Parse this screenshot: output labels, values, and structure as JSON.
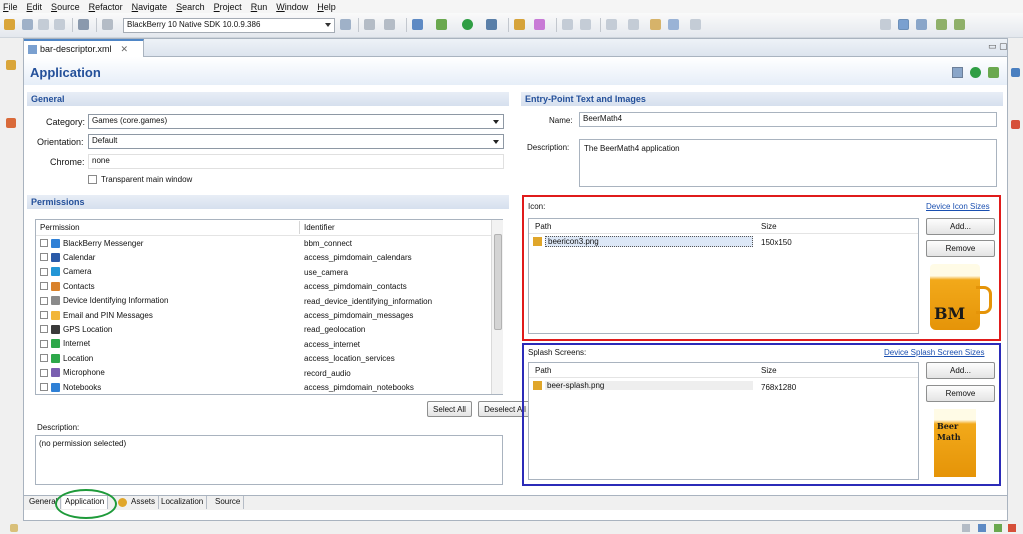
{
  "menu": [
    "File",
    "Edit",
    "Source",
    "Refactor",
    "Navigate",
    "Search",
    "Project",
    "Run",
    "Window",
    "Help"
  ],
  "toolbar": {
    "sdk_selection": "BlackBerry 10 Native SDK 10.0.9.386"
  },
  "editor": {
    "file_tab": "bar-descriptor.xml",
    "page_title": "Application"
  },
  "general": {
    "header": "General",
    "category_label": "Category:",
    "category_value": "Games (core.games)",
    "orientation_label": "Orientation:",
    "orientation_value": "Default",
    "chrome_label": "Chrome:",
    "chrome_value": "none",
    "transparent_label": "Transparent main window"
  },
  "permissions": {
    "header": "Permissions",
    "col_permission": "Permission",
    "col_identifier": "Identifier",
    "rows": [
      {
        "name": "BlackBerry Messenger",
        "id": "bbm_connect",
        "color": "#2f80d6"
      },
      {
        "name": "Calendar",
        "id": "access_pimdomain_calendars",
        "color": "#2a5aa8"
      },
      {
        "name": "Camera",
        "id": "use_camera",
        "color": "#2396d6"
      },
      {
        "name": "Contacts",
        "id": "access_pimdomain_contacts",
        "color": "#d9822b"
      },
      {
        "name": "Device Identifying Information",
        "id": "read_device_identifying_information",
        "color": "#8a8a8a"
      },
      {
        "name": "Email and PIN Messages",
        "id": "access_pimdomain_messages",
        "color": "#f2b63a"
      },
      {
        "name": "GPS Location",
        "id": "read_geolocation",
        "color": "#3a3a3a"
      },
      {
        "name": "Internet",
        "id": "access_internet",
        "color": "#2da84a"
      },
      {
        "name": "Location",
        "id": "access_location_services",
        "color": "#2da84a"
      },
      {
        "name": "Microphone",
        "id": "record_audio",
        "color": "#7a5fb0"
      },
      {
        "name": "Notebooks",
        "id": "access_pimdomain_notebooks",
        "color": "#2f80d6"
      }
    ],
    "select_all": "Select All",
    "deselect_all": "Deselect All",
    "description_label": "Description:",
    "description_value": "(no permission selected)"
  },
  "entry": {
    "header": "Entry-Point Text and Images",
    "name_label": "Name:",
    "name_value": "BeerMath4",
    "description_label": "Description:",
    "description_value": "The BeerMath4 application"
  },
  "icon": {
    "label": "Icon:",
    "link": "Device Icon Sizes",
    "col_path": "Path",
    "col_size": "Size",
    "file": "beericon3.png",
    "size": "150x150",
    "add": "Add...",
    "remove": "Remove",
    "preview_text": "BM"
  },
  "splash": {
    "label": "Splash Screens:",
    "link": "Device Splash Screen Sizes",
    "col_path": "Path",
    "col_size": "Size",
    "file": "beer-splash.png",
    "size": "768x1280",
    "add": "Add...",
    "remove": "Remove",
    "preview_line1": "Beer",
    "preview_line2": "Math"
  },
  "bottom_tabs": [
    "General",
    "Application",
    "Assets",
    "Localization",
    "Source"
  ],
  "colors": {
    "icon_box": "#e01b1b",
    "splash_box": "#2b2bb8",
    "tab_circle": "#1e9a3a"
  }
}
